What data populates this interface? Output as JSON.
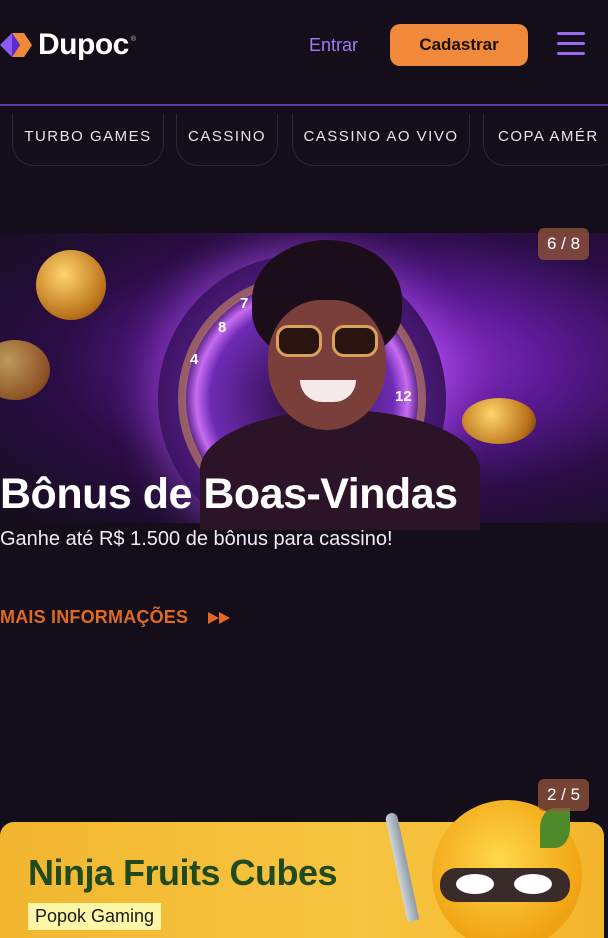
{
  "header": {
    "brand": "Dupoc",
    "brand_mark": "®",
    "login_label": "Entrar",
    "signup_label": "Cadastrar"
  },
  "categories": [
    {
      "label": "TURBO GAMES"
    },
    {
      "label": "CASSINO"
    },
    {
      "label": "CASSINO AO VIVO"
    },
    {
      "label": "COPA AMÉR"
    }
  ],
  "hero": {
    "counter": "6 / 8",
    "title": "Bônus de Boas-Vindas",
    "subtitle": "Ganhe até R$ 1.500 de bônus para cassino!",
    "cta_label": "MAIS INFORMAÇÕES",
    "wheel_numbers": [
      "4",
      "8",
      "7",
      "12"
    ]
  },
  "game_card": {
    "counter": "2 / 5",
    "title": "Ninja Fruits Cubes",
    "provider": "Popok Gaming"
  },
  "colors": {
    "background": "#130e19",
    "accent_purple": "#a478f5",
    "signup_orange": "#f08a3a",
    "cta_orange": "#e06a24",
    "card_yellow": "#f7c541"
  },
  "icons": {
    "logo": "dupoc-logo-icon",
    "menu": "hamburger-menu-icon",
    "cta": "double-arrow-right-icon"
  }
}
